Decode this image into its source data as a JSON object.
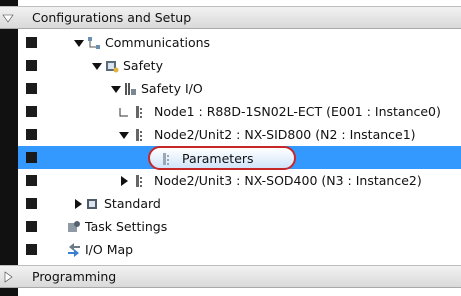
{
  "tree": {
    "sections": {
      "configurations": "Configurations and Setup",
      "programming": "Programming"
    },
    "items": [
      {
        "label": "Communications",
        "icon": "communications-icon"
      },
      {
        "label": "Safety",
        "icon": "safety-icon"
      },
      {
        "label": "Safety I/O",
        "icon": "safety-io-icon"
      },
      {
        "label": "Node1 : R88D-1SN02L-ECT (E001 : Instance0)",
        "icon": "node-icon"
      },
      {
        "label": "Node2/Unit2 : NX-SID800 (N2 : Instance1)",
        "icon": "node-icon"
      },
      {
        "label": "Parameters",
        "icon": "parameters-icon"
      },
      {
        "label": "Node2/Unit3 : NX-SOD400 (N3 : Instance2)",
        "icon": "node-icon"
      },
      {
        "label": "Standard",
        "icon": "standard-icon"
      },
      {
        "label": "Task Settings",
        "icon": "task-settings-icon"
      },
      {
        "label": "I/O Map",
        "icon": "io-map-icon"
      }
    ]
  },
  "colors": {
    "selection": "#3399ff",
    "highlight_border": "#c62828"
  }
}
